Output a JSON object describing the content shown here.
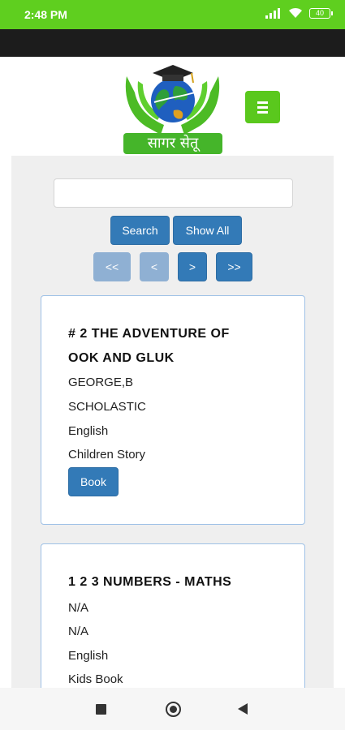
{
  "status_bar": {
    "time": "2:48 PM",
    "battery": "40"
  },
  "header": {
    "logo_text": "सागर सेतू",
    "menu_icon": "hamburger-icon"
  },
  "search": {
    "value": "",
    "placeholder": "",
    "search_label": "Search",
    "show_all_label": "Show All"
  },
  "pagination": {
    "first": "<<",
    "prev": "<",
    "next": ">",
    "last": ">>"
  },
  "books": [
    {
      "title_line1": "# 2 THE ADVENTURE OF",
      "title_line2": "OOK AND GLUK",
      "author": "GEORGE,B",
      "publisher": "SCHOLASTIC",
      "language": "English",
      "category": "Children Story",
      "action_label": "Book"
    },
    {
      "title_line1": "1 2 3 NUMBERS - MATHS",
      "title_line2": "",
      "author": "N/A",
      "publisher": "N/A",
      "language": "English",
      "category": "Kids Book"
    }
  ],
  "colors": {
    "status_bar": "#5fcf1f",
    "primary": "#337ab7",
    "menu_button": "#5ac81d",
    "card_border": "#9ec1e6"
  },
  "nav_bar": {
    "icons": [
      "recent-apps-icon",
      "home-icon",
      "back-icon"
    ]
  }
}
